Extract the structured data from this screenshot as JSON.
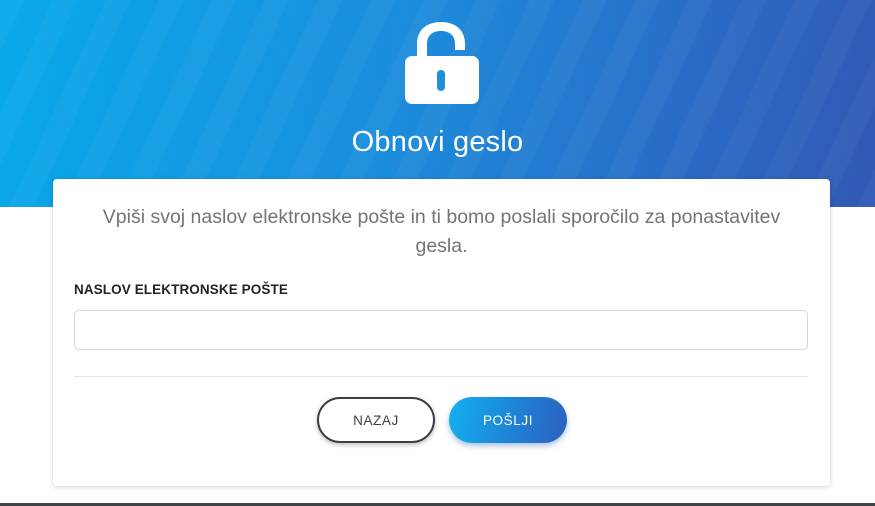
{
  "header": {
    "icon": "unlock-icon",
    "title": "Obnovi geslo",
    "colors": {
      "gradient_start": "#08a9ea",
      "gradient_end": "#3158b4"
    }
  },
  "card": {
    "intro": "Vpiši svoj naslov elektronske pošte in ti bomo poslali sporočilo za ponastavitev gesla.",
    "email": {
      "label": "NASLOV ELEKTRONSKE POŠTE",
      "value": "",
      "placeholder": ""
    },
    "buttons": {
      "back_label": "NAZAJ",
      "send_label": "POŠLJI"
    }
  }
}
